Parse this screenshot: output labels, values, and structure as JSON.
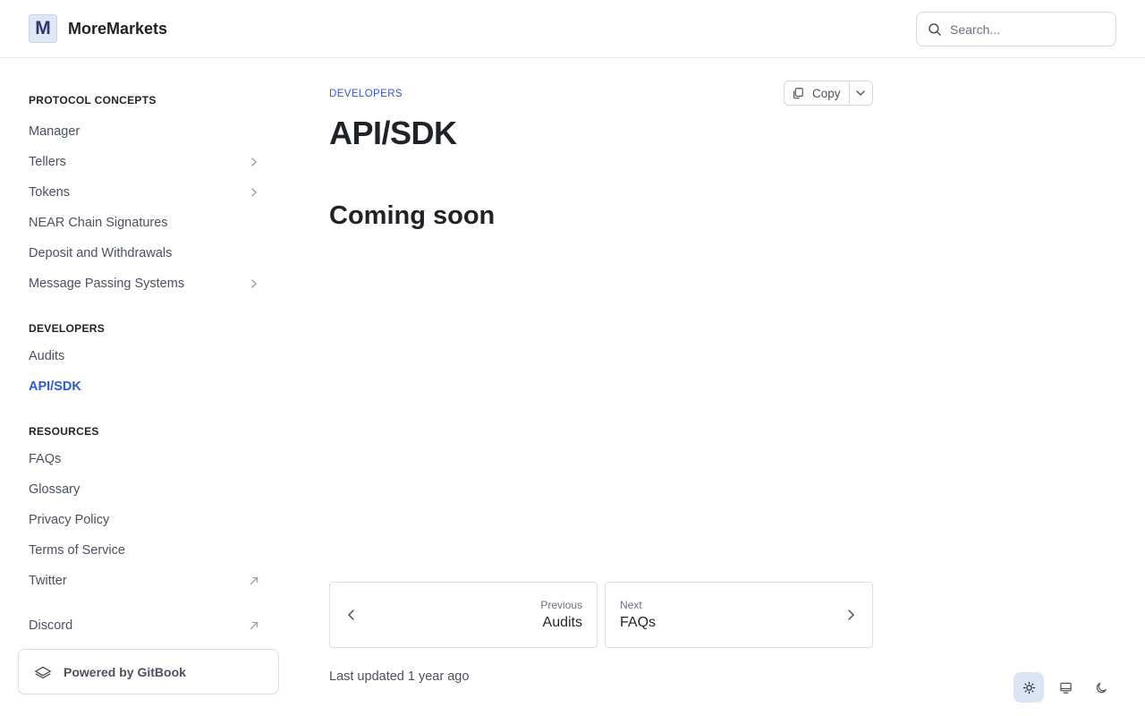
{
  "header": {
    "logo_letter": "M",
    "brand": "MoreMarkets",
    "search_placeholder": "Search..."
  },
  "sidebar": {
    "sections": [
      {
        "title": "PROTOCOL CONCEPTS",
        "items": [
          {
            "label": "Manager"
          },
          {
            "label": "Tellers"
          },
          {
            "label": "Tokens"
          },
          {
            "label": "NEAR Chain Signatures"
          },
          {
            "label": "Deposit and Withdrawals"
          },
          {
            "label": "Message Passing Systems"
          }
        ]
      },
      {
        "title": "DEVELOPERS",
        "items": [
          {
            "label": "Audits"
          },
          {
            "label": "API/SDK"
          }
        ]
      },
      {
        "title": "RESOURCES",
        "items": [
          {
            "label": "FAQs"
          },
          {
            "label": "Glossary"
          },
          {
            "label": "Privacy Policy"
          },
          {
            "label": "Terms of Service"
          },
          {
            "label": "Twitter"
          },
          {
            "label": "Discord"
          }
        ]
      }
    ],
    "powered_by": "Powered by GitBook"
  },
  "main": {
    "breadcrumb": "DEVELOPERS",
    "title": "API/SDK",
    "copy_label": "Copy",
    "heading": "Coming soon",
    "prev": {
      "label": "Previous",
      "title": "Audits"
    },
    "next": {
      "label": "Next",
      "title": "FAQs"
    },
    "updated_prefix": "Last updated",
    "updated_value": "1 year ago"
  },
  "colors": {
    "accent": "#2c5bd7",
    "active_theme_bg": "#dbe5f5"
  }
}
